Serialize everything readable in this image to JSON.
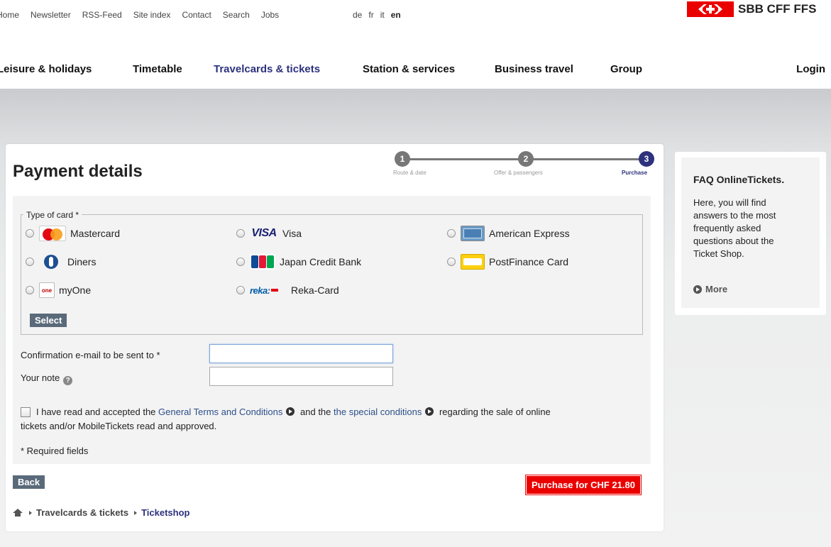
{
  "meta_nav": [
    "Home",
    "Newsletter",
    "RSS-Feed",
    "Site index",
    "Contact",
    "Search",
    "Jobs"
  ],
  "languages": [
    "de",
    "fr",
    "it",
    "en"
  ],
  "logo": {
    "text": "SBB CFF FFS",
    "color": "#eb0000"
  },
  "main_nav": [
    "Leisure & holidays",
    "Timetable",
    "Travelcards & tickets",
    "Station & services",
    "Business travel",
    "Group"
  ],
  "login_label": "Login",
  "page_title": "Payment details",
  "progress": {
    "steps": [
      {
        "num": "1",
        "label": "Route & date"
      },
      {
        "num": "2",
        "label": "Offer & passengers"
      },
      {
        "num": "3",
        "label": "Purchase"
      }
    ],
    "active_step": 3
  },
  "card_section": {
    "legend": "Type of card *",
    "options": [
      {
        "label": "Mastercard",
        "icon": "mastercard-icon"
      },
      {
        "label": "Visa",
        "icon": "visa-icon",
        "logo_text": "VISA"
      },
      {
        "label": "American Express",
        "icon": "amex-icon"
      },
      {
        "label": "Diners",
        "icon": "diners-icon"
      },
      {
        "label": "Japan Credit Bank",
        "icon": "jcb-icon"
      },
      {
        "label": "PostFinance Card",
        "icon": "postfinance-icon"
      },
      {
        "label": "myOne",
        "icon": "myone-icon",
        "logo_text": "one"
      },
      {
        "label": "Reka-Card",
        "icon": "reka-icon",
        "logo_text": "reka:"
      }
    ],
    "select_label": "Select"
  },
  "email_field": {
    "label": "Confirmation e-mail to be sent to *",
    "value": ""
  },
  "note_field": {
    "label": "Your note",
    "value": ""
  },
  "terms": {
    "prefix": "I have read and accepted the",
    "link1": "General Terms and Conditions",
    "middle": "and the",
    "link2": "the special conditions",
    "suffix": "regarding the sale of online",
    "line2": "tickets and/or MobileTickets read and approved."
  },
  "required_note": "* Required fields",
  "back_label": "Back",
  "purchase_label": "Purchase for CHF 21.80",
  "breadcrumb": [
    "Travelcards & tickets",
    "Ticketshop"
  ],
  "faq": {
    "title": "FAQ OnlineTickets.",
    "text": "Here, you will find answers to the most frequently asked questions about the Ticket Shop.",
    "more_label": "More"
  },
  "colors": {
    "brand_blue": "#2d327d",
    "purchase_red": "#eb0000"
  }
}
